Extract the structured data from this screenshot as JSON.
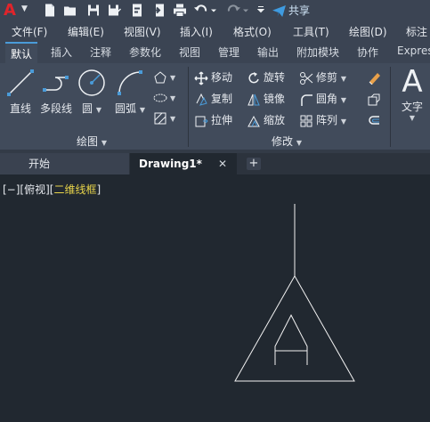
{
  "quick_access": {
    "logo": "A",
    "share_label": "共享"
  },
  "menu": [
    "文件(F)",
    "编辑(E)",
    "视图(V)",
    "插入(I)",
    "格式(O)",
    "工具(T)",
    "绘图(D)",
    "标注"
  ],
  "ribbon_tabs": [
    "默认",
    "插入",
    "注释",
    "参数化",
    "视图",
    "管理",
    "输出",
    "附加模块",
    "协作",
    "Expres"
  ],
  "draw_group": {
    "line": "直线",
    "polyline": "多段线",
    "circle": "圆",
    "arc": "圆弧",
    "title": "绘图"
  },
  "modify_group": {
    "move": "移动",
    "rotate": "旋转",
    "trim": "修剪",
    "copy": "复制",
    "mirror": "镜像",
    "fillet": "圆角",
    "stretch": "拉伸",
    "scale": "缩放",
    "array": "阵列",
    "title": "修改"
  },
  "annotation_group": {
    "text": "文字",
    "text_glyph": "A"
  },
  "doc_tabs": {
    "start": "开始",
    "drawing": "Drawing1*",
    "close": "✕",
    "new": "+"
  },
  "viewport_label": {
    "prefix": "[−][俯视][",
    "visual_style": "二维线框",
    "suffix": "]"
  },
  "colors": {
    "background": "#212830",
    "accent": "#4a9bd8",
    "logo_red": "#e0242b",
    "visual_style_yellow": "#e8d44a"
  }
}
